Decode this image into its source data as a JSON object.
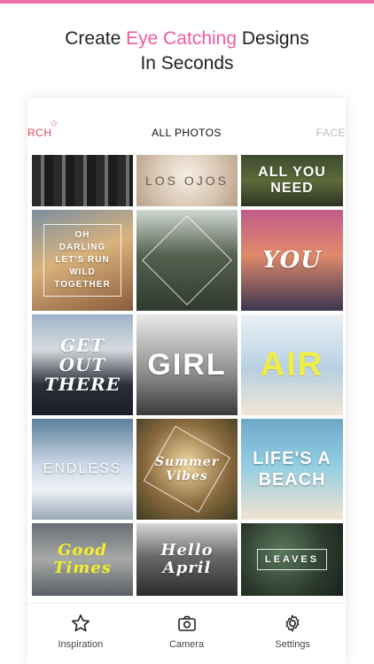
{
  "promo": {
    "line1_prefix": "Create ",
    "line1_accent": "Eye Catching",
    "line1_suffix": " Designs",
    "line2": "In Seconds"
  },
  "tabs": {
    "left_partial": "RCH",
    "center": "ALL PHOTOS",
    "right_partial": "FACE"
  },
  "tiles": [
    {
      "caption": ""
    },
    {
      "caption": "LOS OJOS"
    },
    {
      "caption": "ALL YOU NEED"
    },
    {
      "caption": "OH DARLING LET'S RUN WILD TOGETHER"
    },
    {
      "caption": ""
    },
    {
      "caption": "YOU"
    },
    {
      "caption": "GET OUT THERE"
    },
    {
      "caption": "GIRL"
    },
    {
      "caption": "AIR"
    },
    {
      "caption": "ENDLESS"
    },
    {
      "caption": "Summer Vibes"
    },
    {
      "caption": "LIFE'S A BEACH"
    },
    {
      "caption": "Good Times"
    },
    {
      "caption": "Hello April"
    },
    {
      "caption": "LEAVES"
    }
  ],
  "bottom_nav": [
    {
      "label": "Inspiration",
      "icon": "star-icon"
    },
    {
      "label": "Camera",
      "icon": "camera-icon"
    },
    {
      "label": "Settings",
      "icon": "gear-icon"
    }
  ],
  "colors": {
    "accent_pink": "#ef5ba1",
    "top_bar": "#f06eaa",
    "tab_left": "#e14b5f"
  }
}
